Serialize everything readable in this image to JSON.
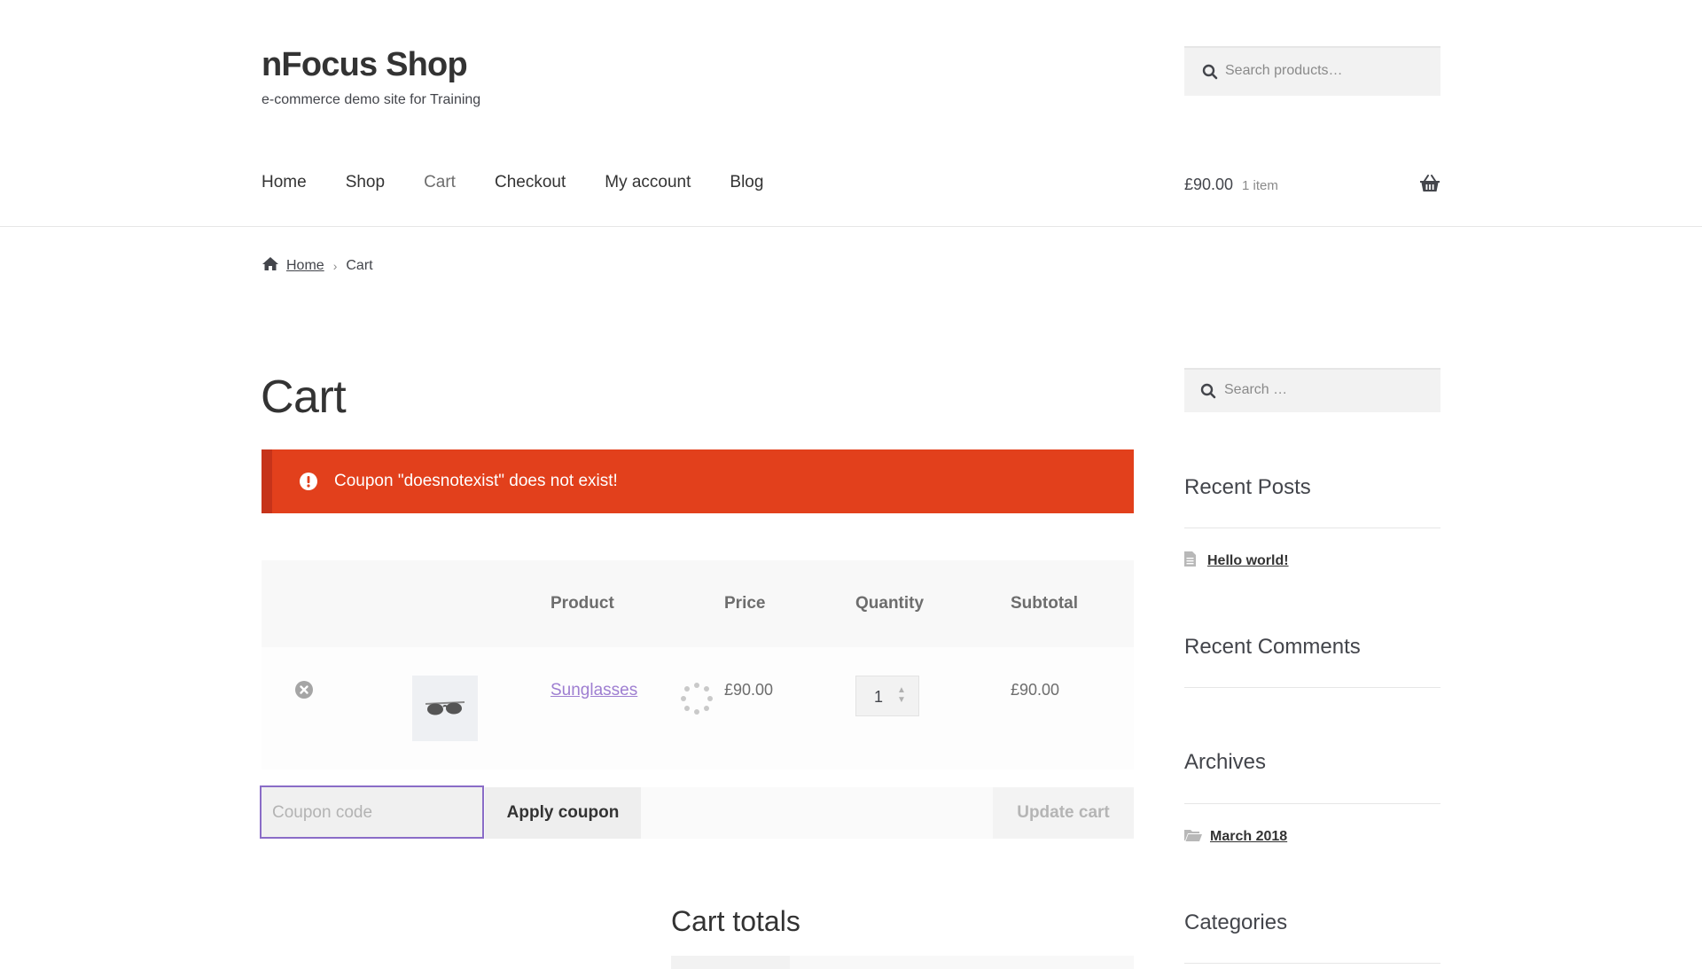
{
  "site": {
    "title": "nFocus Shop",
    "description": "e-commerce demo site for Training"
  },
  "header_search": {
    "placeholder": "Search products…",
    "icon": "search-icon"
  },
  "nav": {
    "items": [
      {
        "label": "Home"
      },
      {
        "label": "Shop"
      },
      {
        "label": "Cart",
        "current": true
      },
      {
        "label": "Checkout"
      },
      {
        "label": "My account"
      },
      {
        "label": "Blog"
      }
    ]
  },
  "mini_cart": {
    "amount": "£90.00",
    "count": "1 item",
    "icon": "basket-icon"
  },
  "breadcrumb": {
    "home": "Home",
    "separator": "›",
    "current": "Cart"
  },
  "page": {
    "title": "Cart"
  },
  "notice": {
    "message": "Coupon \"doesnotexist\" does not exist!",
    "color": "#e2401c"
  },
  "cart_table": {
    "headers": {
      "product": "Product",
      "price": "Price",
      "quantity": "Quantity",
      "subtotal": "Subtotal"
    },
    "rows": [
      {
        "product": "Sunglasses",
        "price": "£90.00",
        "quantity": "1",
        "subtotal": "£90.00"
      }
    ]
  },
  "actions": {
    "coupon_placeholder": "Coupon code",
    "apply_label": "Apply coupon",
    "update_label": "Update cart"
  },
  "cart_totals": {
    "title": "Cart totals"
  },
  "sidebar": {
    "search_placeholder": "Search …",
    "recent_posts": {
      "title": "Recent Posts",
      "items": [
        "Hello world!"
      ]
    },
    "recent_comments": {
      "title": "Recent Comments"
    },
    "archives": {
      "title": "Archives",
      "items": [
        "March 2018"
      ]
    },
    "categories": {
      "title": "Categories"
    }
  },
  "colors": {
    "accent_link": "#9e7ed1",
    "focus_border": "#8a6cc7",
    "error": "#e2401c"
  }
}
